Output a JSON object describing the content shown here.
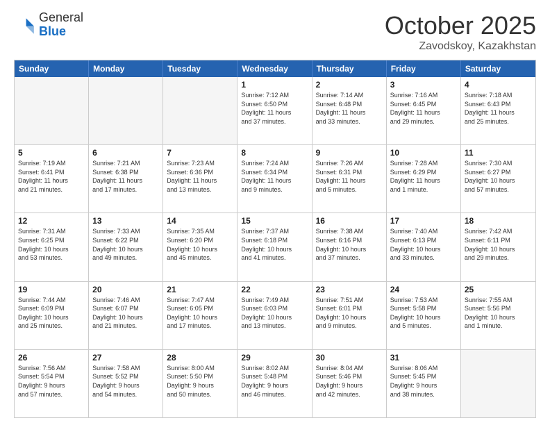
{
  "header": {
    "logo_line1": "General",
    "logo_line2": "Blue",
    "month": "October 2025",
    "location": "Zavodskoy, Kazakhstan"
  },
  "days_of_week": [
    "Sunday",
    "Monday",
    "Tuesday",
    "Wednesday",
    "Thursday",
    "Friday",
    "Saturday"
  ],
  "weeks": [
    [
      {
        "day": "",
        "info": "",
        "empty": true
      },
      {
        "day": "",
        "info": "",
        "empty": true
      },
      {
        "day": "",
        "info": "",
        "empty": true
      },
      {
        "day": "1",
        "info": "Sunrise: 7:12 AM\nSunset: 6:50 PM\nDaylight: 11 hours\nand 37 minutes.",
        "empty": false
      },
      {
        "day": "2",
        "info": "Sunrise: 7:14 AM\nSunset: 6:48 PM\nDaylight: 11 hours\nand 33 minutes.",
        "empty": false
      },
      {
        "day": "3",
        "info": "Sunrise: 7:16 AM\nSunset: 6:45 PM\nDaylight: 11 hours\nand 29 minutes.",
        "empty": false
      },
      {
        "day": "4",
        "info": "Sunrise: 7:18 AM\nSunset: 6:43 PM\nDaylight: 11 hours\nand 25 minutes.",
        "empty": false
      }
    ],
    [
      {
        "day": "5",
        "info": "Sunrise: 7:19 AM\nSunset: 6:41 PM\nDaylight: 11 hours\nand 21 minutes.",
        "empty": false
      },
      {
        "day": "6",
        "info": "Sunrise: 7:21 AM\nSunset: 6:38 PM\nDaylight: 11 hours\nand 17 minutes.",
        "empty": false
      },
      {
        "day": "7",
        "info": "Sunrise: 7:23 AM\nSunset: 6:36 PM\nDaylight: 11 hours\nand 13 minutes.",
        "empty": false
      },
      {
        "day": "8",
        "info": "Sunrise: 7:24 AM\nSunset: 6:34 PM\nDaylight: 11 hours\nand 9 minutes.",
        "empty": false
      },
      {
        "day": "9",
        "info": "Sunrise: 7:26 AM\nSunset: 6:31 PM\nDaylight: 11 hours\nand 5 minutes.",
        "empty": false
      },
      {
        "day": "10",
        "info": "Sunrise: 7:28 AM\nSunset: 6:29 PM\nDaylight: 11 hours\nand 1 minute.",
        "empty": false
      },
      {
        "day": "11",
        "info": "Sunrise: 7:30 AM\nSunset: 6:27 PM\nDaylight: 10 hours\nand 57 minutes.",
        "empty": false
      }
    ],
    [
      {
        "day": "12",
        "info": "Sunrise: 7:31 AM\nSunset: 6:25 PM\nDaylight: 10 hours\nand 53 minutes.",
        "empty": false
      },
      {
        "day": "13",
        "info": "Sunrise: 7:33 AM\nSunset: 6:22 PM\nDaylight: 10 hours\nand 49 minutes.",
        "empty": false
      },
      {
        "day": "14",
        "info": "Sunrise: 7:35 AM\nSunset: 6:20 PM\nDaylight: 10 hours\nand 45 minutes.",
        "empty": false
      },
      {
        "day": "15",
        "info": "Sunrise: 7:37 AM\nSunset: 6:18 PM\nDaylight: 10 hours\nand 41 minutes.",
        "empty": false
      },
      {
        "day": "16",
        "info": "Sunrise: 7:38 AM\nSunset: 6:16 PM\nDaylight: 10 hours\nand 37 minutes.",
        "empty": false
      },
      {
        "day": "17",
        "info": "Sunrise: 7:40 AM\nSunset: 6:13 PM\nDaylight: 10 hours\nand 33 minutes.",
        "empty": false
      },
      {
        "day": "18",
        "info": "Sunrise: 7:42 AM\nSunset: 6:11 PM\nDaylight: 10 hours\nand 29 minutes.",
        "empty": false
      }
    ],
    [
      {
        "day": "19",
        "info": "Sunrise: 7:44 AM\nSunset: 6:09 PM\nDaylight: 10 hours\nand 25 minutes.",
        "empty": false
      },
      {
        "day": "20",
        "info": "Sunrise: 7:46 AM\nSunset: 6:07 PM\nDaylight: 10 hours\nand 21 minutes.",
        "empty": false
      },
      {
        "day": "21",
        "info": "Sunrise: 7:47 AM\nSunset: 6:05 PM\nDaylight: 10 hours\nand 17 minutes.",
        "empty": false
      },
      {
        "day": "22",
        "info": "Sunrise: 7:49 AM\nSunset: 6:03 PM\nDaylight: 10 hours\nand 13 minutes.",
        "empty": false
      },
      {
        "day": "23",
        "info": "Sunrise: 7:51 AM\nSunset: 6:01 PM\nDaylight: 10 hours\nand 9 minutes.",
        "empty": false
      },
      {
        "day": "24",
        "info": "Sunrise: 7:53 AM\nSunset: 5:58 PM\nDaylight: 10 hours\nand 5 minutes.",
        "empty": false
      },
      {
        "day": "25",
        "info": "Sunrise: 7:55 AM\nSunset: 5:56 PM\nDaylight: 10 hours\nand 1 minute.",
        "empty": false
      }
    ],
    [
      {
        "day": "26",
        "info": "Sunrise: 7:56 AM\nSunset: 5:54 PM\nDaylight: 9 hours\nand 57 minutes.",
        "empty": false
      },
      {
        "day": "27",
        "info": "Sunrise: 7:58 AM\nSunset: 5:52 PM\nDaylight: 9 hours\nand 54 minutes.",
        "empty": false
      },
      {
        "day": "28",
        "info": "Sunrise: 8:00 AM\nSunset: 5:50 PM\nDaylight: 9 hours\nand 50 minutes.",
        "empty": false
      },
      {
        "day": "29",
        "info": "Sunrise: 8:02 AM\nSunset: 5:48 PM\nDaylight: 9 hours\nand 46 minutes.",
        "empty": false
      },
      {
        "day": "30",
        "info": "Sunrise: 8:04 AM\nSunset: 5:46 PM\nDaylight: 9 hours\nand 42 minutes.",
        "empty": false
      },
      {
        "day": "31",
        "info": "Sunrise: 8:06 AM\nSunset: 5:45 PM\nDaylight: 9 hours\nand 38 minutes.",
        "empty": false
      },
      {
        "day": "",
        "info": "",
        "empty": true
      }
    ]
  ]
}
